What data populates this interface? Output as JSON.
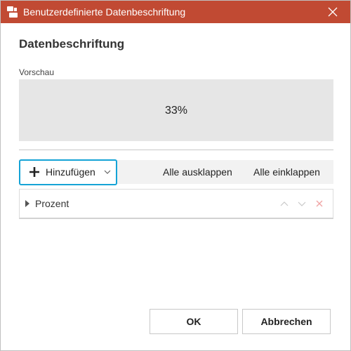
{
  "window": {
    "title": "Benutzerdefinierte Datenbeschriftung"
  },
  "dialog": {
    "heading": "Datenbeschriftung",
    "preview_label": "Vorschau",
    "preview_value": "33%"
  },
  "toolbar": {
    "add_label": "Hinzufügen",
    "expand_all": "Alle ausklappen",
    "collapse_all": "Alle einklappen"
  },
  "list": {
    "items": [
      {
        "label": "Prozent"
      }
    ]
  },
  "footer": {
    "ok": "OK",
    "cancel": "Abbrechen"
  },
  "colors": {
    "titlebar": "#c14a33",
    "focus_outline": "#15a3d6",
    "delete_icon": "#f0a5a5",
    "move_icons": "#c8c8c8"
  },
  "icons": [
    "app-icon",
    "close-icon",
    "plus-icon",
    "chevron-down-icon",
    "expand-arrow-icon",
    "move-up-icon",
    "move-down-icon",
    "delete-icon"
  ]
}
